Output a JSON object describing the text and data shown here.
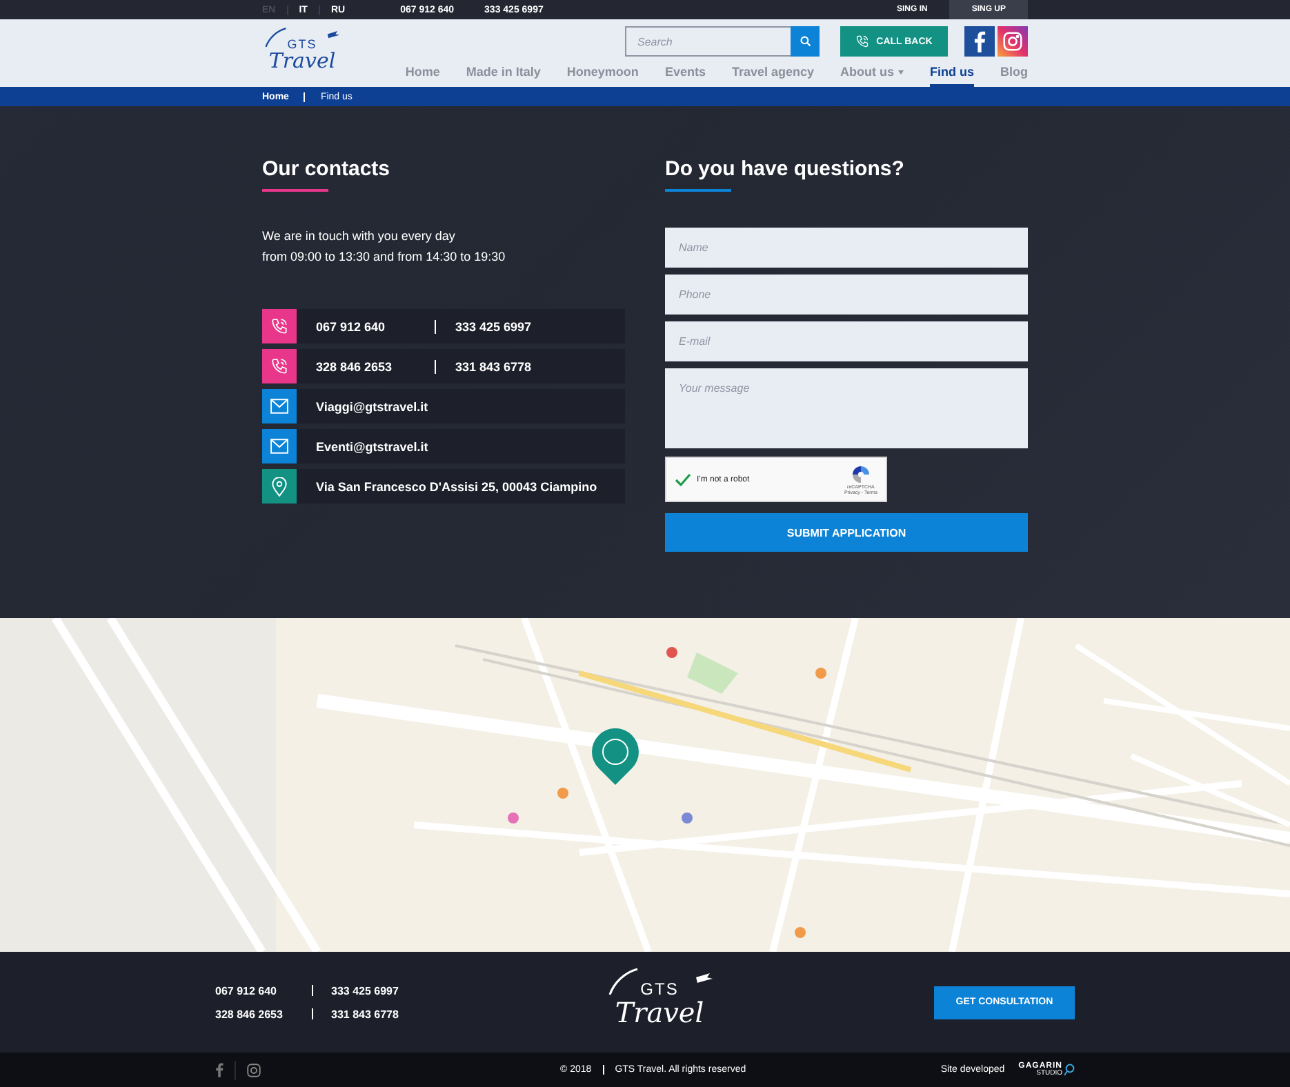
{
  "top_bar": {
    "languages": [
      {
        "label": "EN",
        "selected": true
      },
      {
        "label": "IT",
        "selected": false
      },
      {
        "label": "RU",
        "selected": false
      }
    ],
    "phones": [
      "067 912 640",
      "333 425 6997"
    ],
    "auth_buttons": [
      {
        "label": "SING IN",
        "selected": false
      },
      {
        "label": "SING UP",
        "selected": true
      }
    ]
  },
  "header": {
    "logo": {
      "top": "GTS",
      "bottom": "Travel"
    },
    "search": {
      "placeholder": "Search"
    },
    "call_back": "CALL BACK",
    "nav": [
      {
        "label": "Home",
        "selected": false,
        "dropdown": false
      },
      {
        "label": "Made in Italy",
        "selected": false,
        "dropdown": false
      },
      {
        "label": "Honeymoon",
        "selected": false,
        "dropdown": false
      },
      {
        "label": "Events",
        "selected": false,
        "dropdown": false
      },
      {
        "label": "Travel agency",
        "selected": false,
        "dropdown": false
      },
      {
        "label": "About us",
        "selected": false,
        "dropdown": true
      },
      {
        "label": "Find us",
        "selected": true,
        "dropdown": false
      },
      {
        "label": "Blog",
        "selected": false,
        "dropdown": false
      }
    ]
  },
  "breadcrumb": [
    "Home",
    "Find us"
  ],
  "contacts": {
    "title": "Our contacts",
    "intro": [
      "We are in touch with you every day",
      "from 09:00 to 13:30 and from 14:30 to 19:30"
    ],
    "rows": [
      {
        "kind": "phone",
        "values": [
          "067 912 640",
          "333 425 6997"
        ]
      },
      {
        "kind": "phone",
        "values": [
          "328 846 2653",
          "331 843 6778"
        ]
      },
      {
        "kind": "email",
        "values": [
          "Viaggi@gtstravel.it"
        ]
      },
      {
        "kind": "email",
        "values": [
          "Eventi@gtstravel.it"
        ]
      },
      {
        "kind": "location",
        "values": [
          "Via San Francesco D'Assisi 25, 00043 Ciampino"
        ]
      }
    ]
  },
  "form": {
    "title": "Do you have questions?",
    "fields": [
      {
        "kind": "input",
        "placeholder": "Name"
      },
      {
        "kind": "input",
        "placeholder": "Phone"
      },
      {
        "kind": "input",
        "placeholder": "E-mail"
      },
      {
        "kind": "textarea",
        "placeholder": "Your message"
      }
    ],
    "captcha": {
      "label": "I'm not a robot",
      "checked": true,
      "brand": "reCAPTCHA",
      "links": "Privacy - Terms"
    },
    "submit": "SUBMIT APPLICATION"
  },
  "footer": {
    "phones": [
      [
        "067 912 640",
        "333 425 6997"
      ],
      [
        "328 846 2653",
        "331 843 6778"
      ]
    ],
    "logo": {
      "top": "GTS",
      "bottom": "Travel"
    },
    "button": "GET CONSULTATION"
  },
  "bottom_bar": {
    "year": "© 2018",
    "copyright": "GTS Travel. All rights reserved",
    "developed": "Site developed",
    "studio": "GAGARIN",
    "studio_sub": "STUDIO"
  }
}
